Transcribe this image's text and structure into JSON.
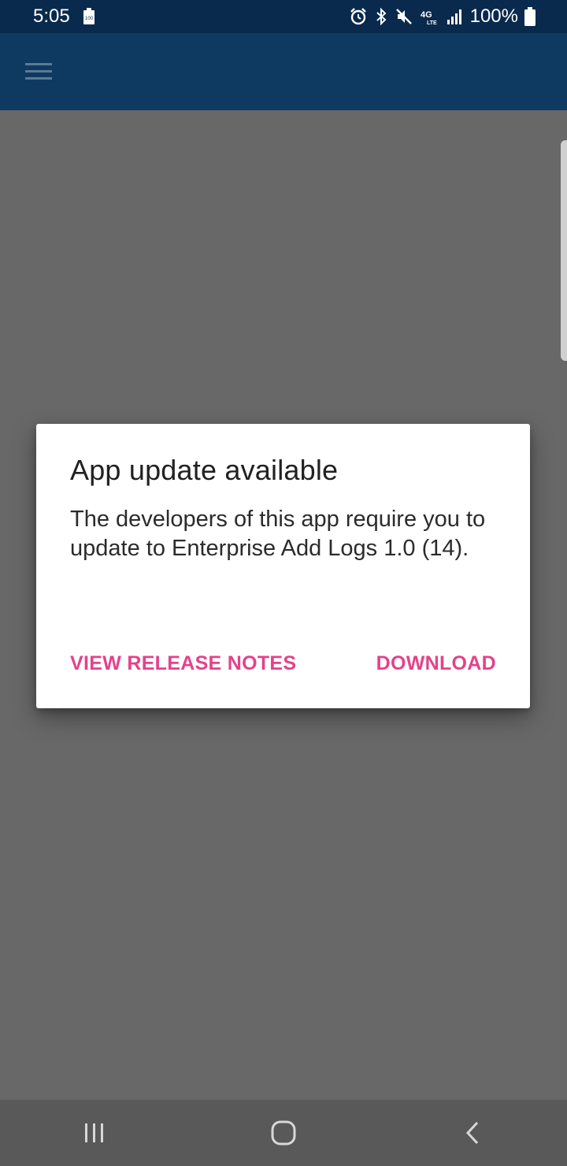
{
  "status_bar": {
    "time": "5:05",
    "battery_text": "100%",
    "icons": [
      "battery-saver-icon",
      "alarm-icon",
      "bluetooth-icon",
      "mute-icon",
      "4g-lte-icon",
      "signal-icon",
      "battery-icon"
    ],
    "mini_battery_label": "100",
    "lte_label": "4G",
    "lte_sub": "LTE"
  },
  "app_bar": {
    "menu_icon": "hamburger-menu-icon",
    "color": "#0e3a62"
  },
  "dialog": {
    "title": "App update available",
    "body": "The developers of this app require you to update to Enterprise Add Logs 1.0 (14).",
    "buttons": {
      "release_notes": "VIEW RELEASE NOTES",
      "download": "DOWNLOAD"
    },
    "accent_color": "#e5428b"
  },
  "nav_bar": {
    "icons": [
      "recents-icon",
      "home-icon",
      "back-icon"
    ]
  },
  "colors": {
    "status_bar": "#092a4d",
    "app_bar": "#0e3a62",
    "scrim": "#686868",
    "nav_bar": "#595959",
    "accent": "#e5428b"
  }
}
